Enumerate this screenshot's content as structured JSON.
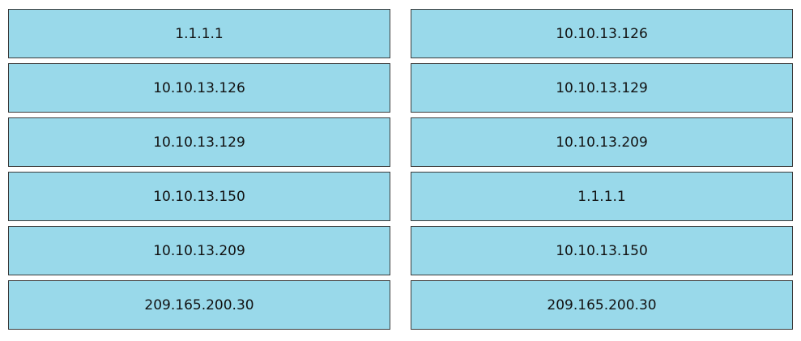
{
  "colors": {
    "tile_background": "#99d9ea",
    "tile_border": "#3a3a3a"
  },
  "left_column": {
    "items": [
      "1.1.1.1",
      "10.10.13.126",
      "10.10.13.129",
      "10.10.13.150",
      "10.10.13.209",
      "209.165.200.30"
    ]
  },
  "right_column": {
    "items": [
      "10.10.13.126",
      "10.10.13.129",
      "10.10.13.209",
      "1.1.1.1",
      "10.10.13.150",
      "209.165.200.30"
    ]
  }
}
